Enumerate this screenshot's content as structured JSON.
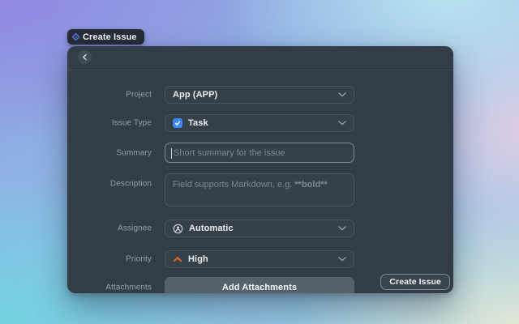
{
  "badge": {
    "label": "Create Issue"
  },
  "form": {
    "project": {
      "label": "Project",
      "value": "App (APP)"
    },
    "issue_type": {
      "label": "Issue Type",
      "value": "Task"
    },
    "summary": {
      "label": "Summary",
      "placeholder": "Short summary for the issue"
    },
    "description": {
      "label": "Description",
      "placeholder_prefix": "Field supports Markdown, e.g. ",
      "placeholder_bold": "**bold**"
    },
    "assignee": {
      "label": "Assignee",
      "value": "Automatic"
    },
    "priority": {
      "label": "Priority",
      "value": "High"
    },
    "attachments": {
      "label": "Attachments",
      "button_label": "Add Attachments"
    }
  },
  "footer": {
    "create_button_label": "Create Issue"
  },
  "colors": {
    "dialog_bg": "#333d47",
    "task_icon_blue": "#3e87f5",
    "priority_high_orange": "#e0612d",
    "badge_icon_blue": "#5d7bf5",
    "focused_border": "#828c96"
  }
}
